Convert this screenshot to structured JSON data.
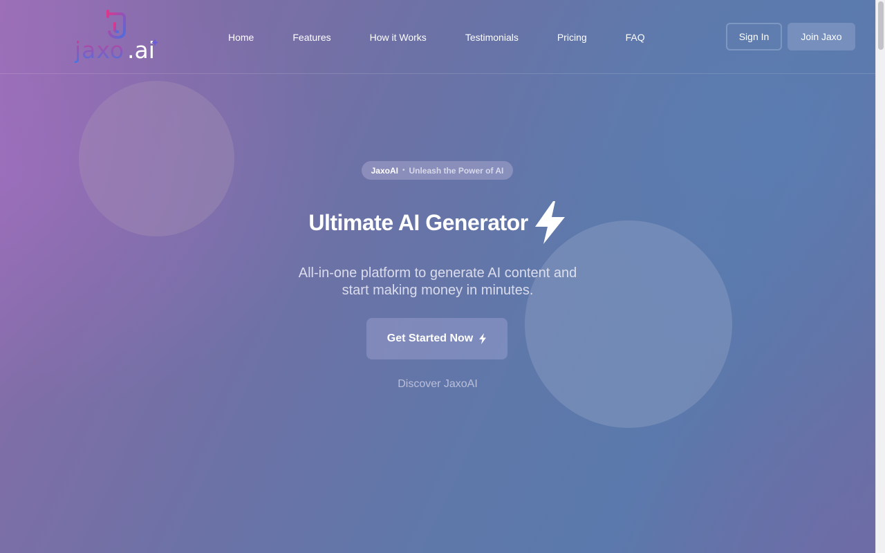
{
  "brand": {
    "logo_text": "jaxo.ai",
    "logo_colors": {
      "start": "#e0358a",
      "end": "#3f78e6"
    }
  },
  "nav": {
    "items": [
      {
        "label": "Home"
      },
      {
        "label": "Features"
      },
      {
        "label": "How it Works"
      },
      {
        "label": "Testimonials"
      },
      {
        "label": "Pricing"
      },
      {
        "label": "FAQ"
      }
    ],
    "sign_in": "Sign In",
    "join": "Join Jaxo"
  },
  "hero": {
    "pill_brand": "JaxoAI",
    "pill_separator": "•",
    "pill_tagline": "Unleash the Power of AI",
    "title": "Ultimate AI Generator",
    "title_icon": "lightning-bolt-icon",
    "subtitle_line1": "All-in-one platform to generate AI content and",
    "subtitle_line2": "start making money in minutes.",
    "cta_label": "Get Started Now",
    "cta_icon": "lightning-bolt-icon",
    "discover_label": "Discover JaxoAI"
  },
  "colors": {
    "background_start": "#9a6fb6",
    "background_end": "#5b79ac",
    "text": "#ffffff"
  }
}
